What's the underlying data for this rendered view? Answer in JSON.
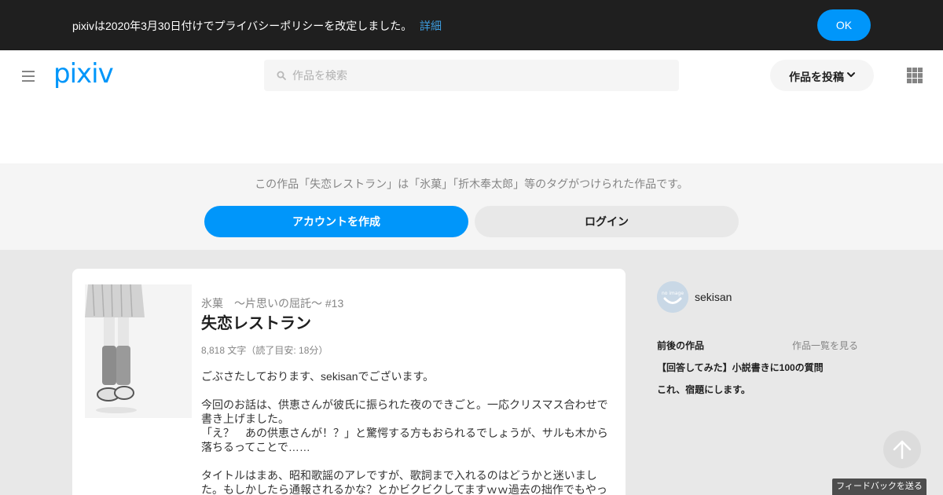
{
  "banner": {
    "message": "pixivは2020年3月30日付けでプライバシーポリシーを改定しました。",
    "details_link": "詳細",
    "ok_label": "OK"
  },
  "header": {
    "logo_text": "pixiv",
    "search_placeholder": "作品を検索",
    "post_button_label": "作品を投稿",
    "menu_icon": "hamburger-icon",
    "apps_icon": "grid-icon"
  },
  "tag_band": {
    "description": "この作品「失恋レストラン」は「氷菓」「折木奉太郎」等のタグがつけられた作品です。",
    "create_account_label": "アカウントを作成",
    "login_label": "ログイン"
  },
  "work": {
    "series": "氷菓　～片思いの屈託～ #13",
    "title": "失恋レストラン",
    "meta": "8,818 文字（読了目安: 18分）",
    "caption": [
      "ごぶさたしております、sekisanでございます。",
      "",
      "今回のお話は、供恵さんが彼氏に振られた夜のできごと。一応クリスマス合わせで書き上げました。",
      "「え？　あの供恵さんが！？」と驚愕する方もおられるでしょうが、サルも木から落ちるってことで……",
      "",
      "タイトルはまあ、昭和歌謡のアレですが、歌詞まで入れるのはどうかと迷いました。もしかしたら通報されるかな？とかビクビクしてますｗｗ過去の拙作でもやっ"
    ]
  },
  "sidebar": {
    "author_name": "sekisan",
    "avatar_text": "no image",
    "nav_heading": "前後の作品",
    "view_all_label": "作品一覧を見る",
    "links": [
      "【回答してみた】小説書きに100の質問",
      "これ、宿題にします。"
    ]
  },
  "floating": {
    "feedback_label": "フィードバックを送る",
    "scroll_top_icon": "arrow-up-icon"
  },
  "colors": {
    "accent": "#0096fa",
    "banner_bg": "#1f1f1f",
    "link": "#3d9ddf"
  }
}
